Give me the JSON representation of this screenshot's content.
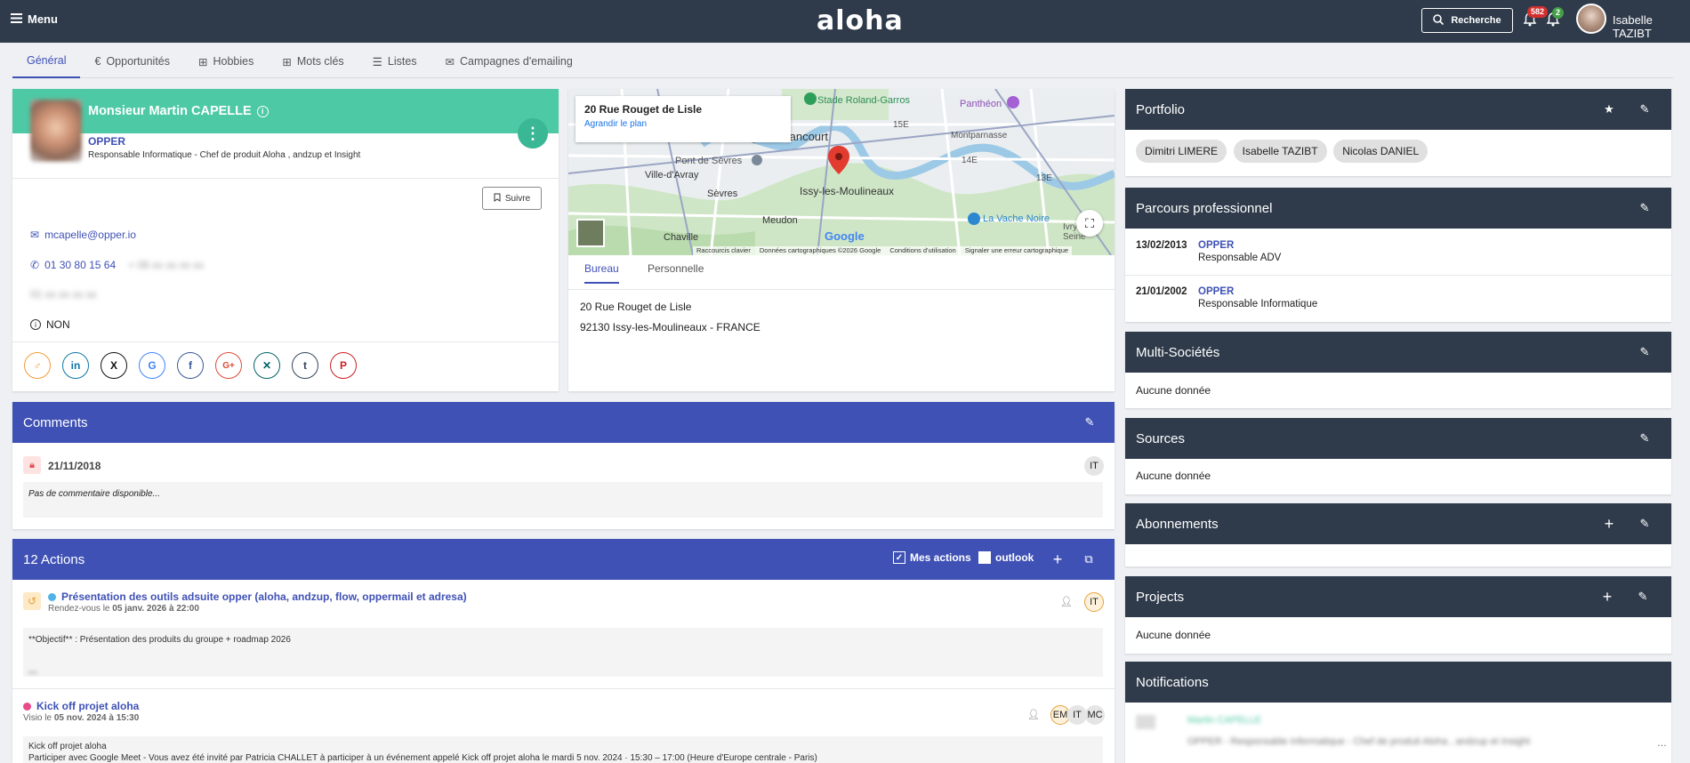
{
  "topbar": {
    "menu_label": "Menu",
    "logo": "aloha",
    "search_label": "Recherche",
    "notif_count_red": "582",
    "notif_count_green": "2",
    "user_name": "Isabelle TAZIBT",
    "colors": {
      "bar": "#2f3b4b",
      "badge_red": "#d32f2f",
      "badge_green": "#43a047"
    }
  },
  "tabs": [
    {
      "label": "Général",
      "icon": "none",
      "active": true
    },
    {
      "label": "Opportunités",
      "icon": "euro-icon"
    },
    {
      "label": "Hobbies",
      "icon": "grid-icon"
    },
    {
      "label": "Mots clés",
      "icon": "grid-icon"
    },
    {
      "label": "Listes",
      "icon": "list-icon"
    },
    {
      "label": "Campagnes d'emailing",
      "icon": "mail-icon"
    }
  ],
  "contact": {
    "name": "Monsieur Martin CAPELLE",
    "company": "OPPER",
    "role": "Responsable Informatique - Chef de produit Aloha , andzup et Insight",
    "follow_label": "Suivre",
    "email": "mcapelle@opper.io",
    "phone": "01 30 80 15 64",
    "phone_blurred": "+ 06 xx xx xx xx",
    "fax_blurred": "01 xx xx xx xx",
    "optin_label": "NON",
    "socials": [
      "viadeo-icon",
      "linkedin-icon",
      "x-icon",
      "google-icon",
      "facebook-icon",
      "google-plus-icon",
      "xing-icon",
      "tumblr-icon",
      "pinterest-icon"
    ],
    "header_color": "#4ec9a5"
  },
  "map": {
    "address_title": "20 Rue Rouget de Lisle",
    "enlarge_link": "Agrandir le plan",
    "labels": [
      "Stade Roland-Garros",
      "Panthéon",
      "Boulogne-Billancourt",
      "Pont de Sèvres",
      "Ville-d'Avray",
      "Sèvres",
      "Issy-les-Moulineaux",
      "Meudon",
      "Chaville",
      "La Vache Noire",
      "Montparnasse",
      "15E",
      "14E",
      "13E",
      "Ivry-sur-Seine"
    ],
    "footer": [
      "Raccourcis clavier",
      "Données cartographiques ©2026 Google",
      "Conditions d'utilisation",
      "Signaler une erreur cartographique"
    ],
    "google_label": "Google",
    "tab_office": "Bureau",
    "tab_personal": "Personnelle",
    "address_line1": "20 Rue Rouget de Lisle",
    "address_line2": "92130 Issy-les-Moulineaux - FRANCE"
  },
  "comments": {
    "title": "Comments",
    "date": "21/11/2018",
    "author_initials": "IT",
    "text": "Pas de commentaire disponible..."
  },
  "actions": {
    "title": "12 Actions",
    "my_actions_label": "Mes actions",
    "outlook_label": "outlook",
    "items": [
      {
        "title": "Présentation des outils adsuite opper (aloha, andzup, flow, oppermail et adresa)",
        "type": "Rendez-vous le",
        "date": "05 janv. 2026 à 22:00",
        "initials": [
          "IT"
        ],
        "body1": "**Objectif** : Présentation des produits du groupe + roadmap 2026",
        "body2": "",
        "dot_color": "#4fb3e8"
      },
      {
        "title": "Kick off projet aloha",
        "type": "Visio le",
        "date": "05 nov. 2024 à 15:30",
        "initials": [
          "EM",
          "IT",
          "MC"
        ],
        "body1": "Kick off projet aloha",
        "body2": "Participer avec Google Meet - Vous avez été invité par Patricia CHALLET à participer à un événement appelé Kick off projet aloha le mardi 5 nov. 2024 · 15:30 – 17:00 (Heure d'Europe centrale - Paris)",
        "dot_color": "#e84a8a"
      }
    ]
  },
  "portfolio": {
    "title": "Portfolio",
    "members": [
      "Dimitri LIMERE",
      "Isabelle TAZIBT",
      "Nicolas DANIEL"
    ]
  },
  "career": {
    "title": "Parcours professionnel",
    "items": [
      {
        "date": "13/02/2013",
        "company": "OPPER",
        "role": "Responsable ADV"
      },
      {
        "date": "21/01/2002",
        "company": "OPPER",
        "role": "Responsable Informatique"
      }
    ]
  },
  "multi": {
    "title": "Multi-Sociétés",
    "empty": "Aucune donnée"
  },
  "sources": {
    "title": "Sources",
    "empty": "Aucune donnée"
  },
  "subscriptions": {
    "title": "Abonnements"
  },
  "projects": {
    "title": "Projects",
    "empty": "Aucune donnée"
  },
  "notifications": {
    "title": "Notifications",
    "blurred_line1": "Martin CAPELLE",
    "blurred_line2": "OPPER - Responsable Informatique - Chef de produit Aloha , andzup et Insight"
  }
}
